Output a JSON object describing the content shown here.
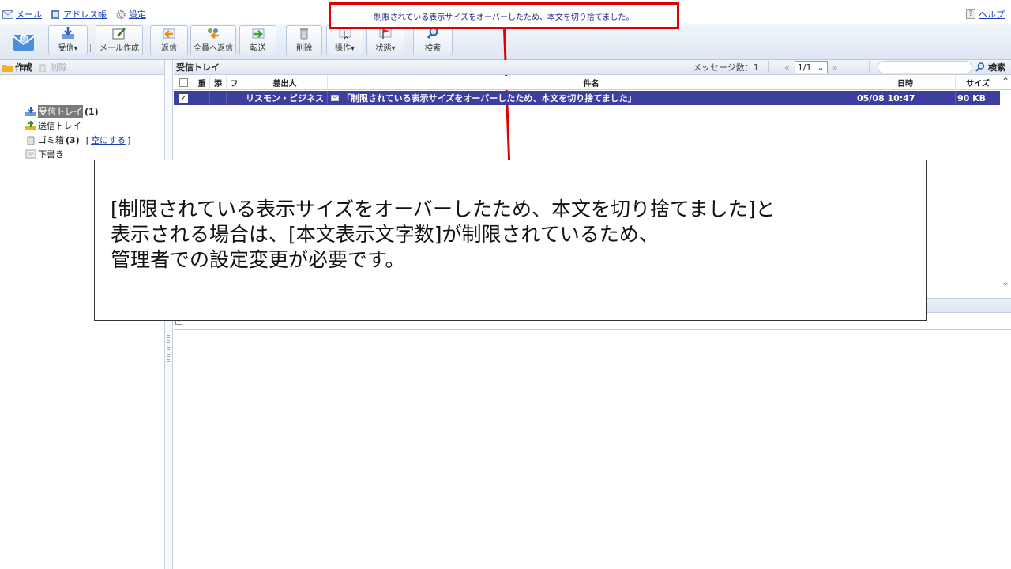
{
  "nav": {
    "mail": "メール",
    "addressbook": "アドレス帳",
    "settings": "設定",
    "help": "ヘルプ",
    "help_mark": "?"
  },
  "notice": "制限されている表示サイズをオーバーしたため、本文を切り捨てました。",
  "toolbar": {
    "receive": "受信▾",
    "compose": "メール作成",
    "reply": "返信",
    "reply_all": "全員へ返信",
    "forward": "転送",
    "delete": "削除",
    "operation": "操作▾",
    "status": "状態▾",
    "search": "検索"
  },
  "left": {
    "create": "作成",
    "delete": "削除",
    "folders": {
      "inbox": "受信トレイ",
      "inbox_count": "(1)",
      "sent": "送信トレイ",
      "trash": "ゴミ箱",
      "trash_count": "(3)",
      "empty_open": "[",
      "empty": "空にする",
      "empty_close": "]",
      "drafts": "下書き"
    }
  },
  "list": {
    "title": "受信トレイ",
    "count": "メッセージ数：1",
    "prev": "«",
    "page": "1/1",
    "next": "»",
    "search_button": "検索",
    "columns": {
      "important": "重",
      "attach": "添",
      "flag": "フ",
      "sender": "差出人",
      "subject": "件名",
      "date": "日時",
      "size": "サイズ"
    },
    "rows": [
      {
        "sender": "リスモン・ビジネス",
        "subject": "「制限されている表示サイズをオーバーしたため、本文を切り捨てました」",
        "date": "05/08 10:47",
        "size": "90 KB",
        "checked": "✓"
      }
    ]
  },
  "callout": {
    "line1": "[制限されている表示サイズをオーバーしたため、本文を切り捨てました]と",
    "line2": "表示される場合は、[本文表示文字数]が制限されているため、",
    "line3": "管理者での設定変更が必要です。"
  }
}
